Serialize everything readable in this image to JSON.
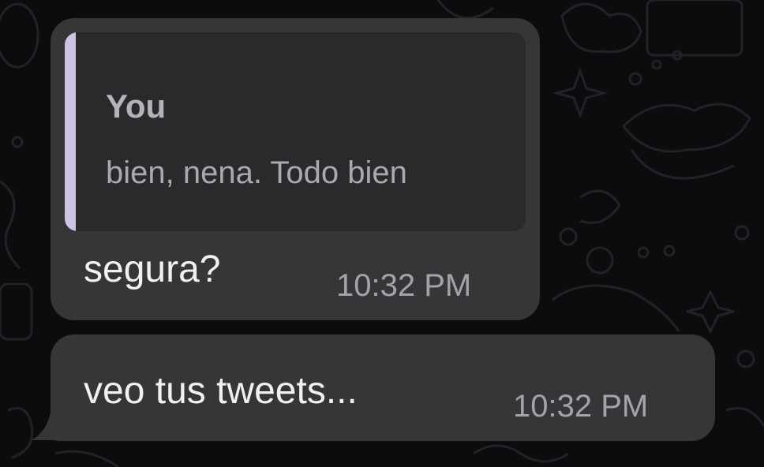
{
  "messages": [
    {
      "reply_to": {
        "sender": "You",
        "text": "bien, nena. Todo bien"
      },
      "text": "segura?",
      "time": "10:32 PM"
    },
    {
      "text": "veo tus tweets...",
      "time": "10:32 PM"
    }
  ],
  "colors": {
    "background": "#0c0c0e",
    "bubble": "#363639",
    "quote_background": "#2a2a2d",
    "quote_bar": "#cfc2e3"
  }
}
